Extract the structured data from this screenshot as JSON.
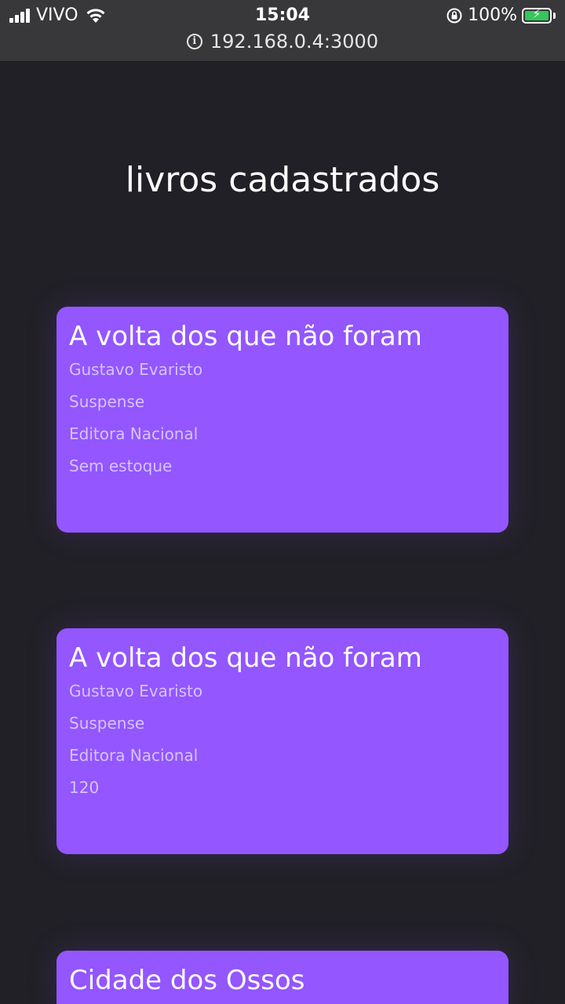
{
  "status_bar": {
    "carrier": "VIVO",
    "time": "15:04",
    "battery": "100%"
  },
  "browser": {
    "url": "192.168.0.4:3000"
  },
  "page": {
    "title": "livros cadastrados"
  },
  "books": [
    {
      "title": "A volta dos que não foram",
      "author": "Gustavo Evaristo",
      "genre": "Suspense",
      "publisher": "Editora Nacional",
      "stock": "Sem estoque"
    },
    {
      "title": "A volta dos que não foram",
      "author": "Gustavo Evaristo",
      "genre": "Suspense",
      "publisher": "Editora Nacional",
      "stock": "120"
    },
    {
      "title": "Cidade dos Ossos"
    }
  ],
  "colors": {
    "background": "#212026",
    "card": "#9356ff",
    "card_secondary_text": "#d6c4ff",
    "status_bar": "#38383b"
  }
}
